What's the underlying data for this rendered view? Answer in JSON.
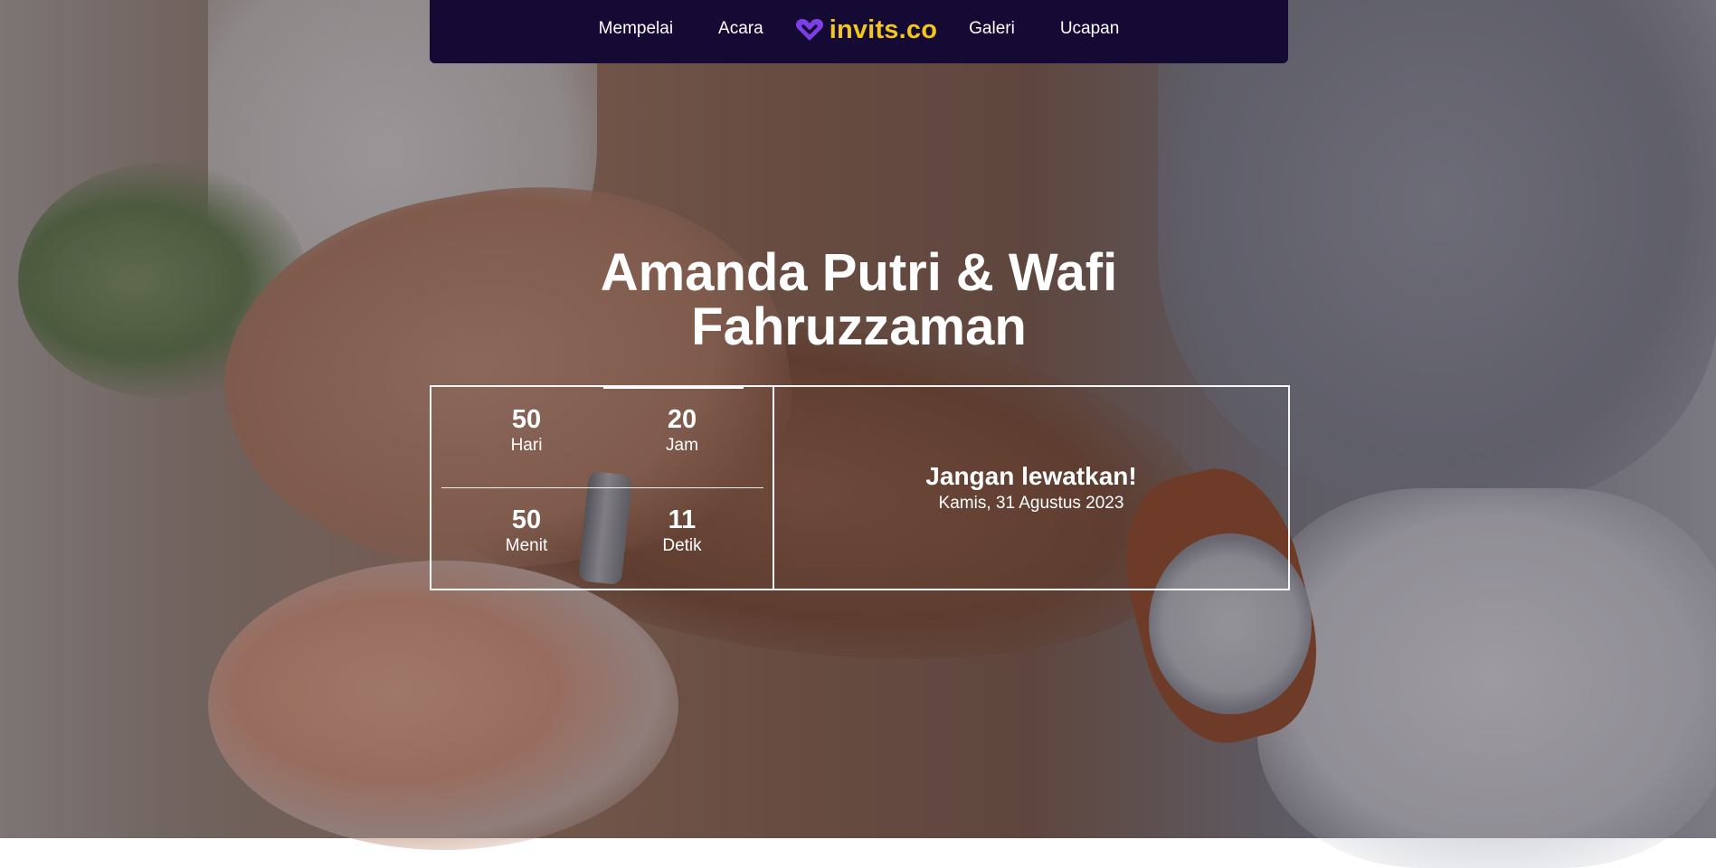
{
  "nav": {
    "items_left": [
      "Mempelai",
      "Acara"
    ],
    "brand": {
      "text": "invits.co",
      "icon": "heart-logo-icon",
      "color": "#f2c51f",
      "icon_color": "#7b3fe4"
    },
    "items_right": [
      "Galeri",
      "Ucapan"
    ],
    "background": "#150a33"
  },
  "hero": {
    "title_line1": "Amanda Putri & Wafi",
    "title_line2": "Fahruzzaman"
  },
  "countdown": {
    "days": {
      "value": "50",
      "label": "Hari"
    },
    "hours": {
      "value": "20",
      "label": "Jam"
    },
    "minutes": {
      "value": "50",
      "label": "Menit"
    },
    "seconds": {
      "value": "11",
      "label": "Detik"
    }
  },
  "reminder": {
    "heading": "Jangan lewatkan!",
    "date": "Kamis, 31 Agustus 2023"
  }
}
